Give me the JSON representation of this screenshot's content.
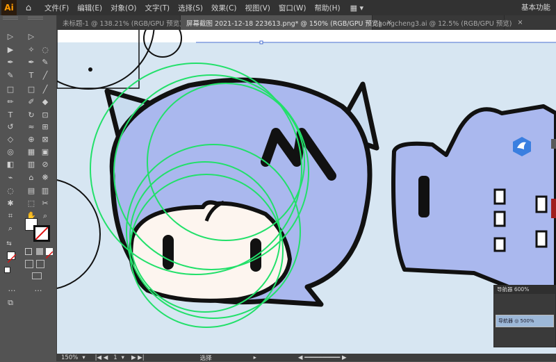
{
  "menubar": {
    "logo": "Ai",
    "items": [
      "文件(F)",
      "编辑(E)",
      "对象(O)",
      "文字(T)",
      "选择(S)",
      "效果(C)",
      "视图(V)",
      "窗口(W)",
      "帮助(H)"
    ],
    "workspace": "基本功能"
  },
  "tabs": [
    {
      "label": "未标题-1 @ 138.21% (RGB/GPU 预览)",
      "close": "×"
    },
    {
      "label": "屏幕截图 2021-12-18 223613.png* @ 150% (RGB/GPU 预览)",
      "close": "×"
    },
    {
      "label": "gongcheng3.ai @ 12.5% (RGB/GPU 预览)",
      "close": "×"
    }
  ],
  "statusbar": {
    "zoom": "150%",
    "artboard": "1",
    "tool": "选择"
  },
  "navigator": {
    "title": "导航器 600%",
    "thumb_text": "导航器 ◎ 500%"
  },
  "colors": {
    "accent": "#ff9a00",
    "hair": "#aab8ee",
    "skin": "#fdf5ef",
    "outline": "#111111",
    "guide_circle": "#22e06a",
    "background": "#d7e6f2"
  }
}
